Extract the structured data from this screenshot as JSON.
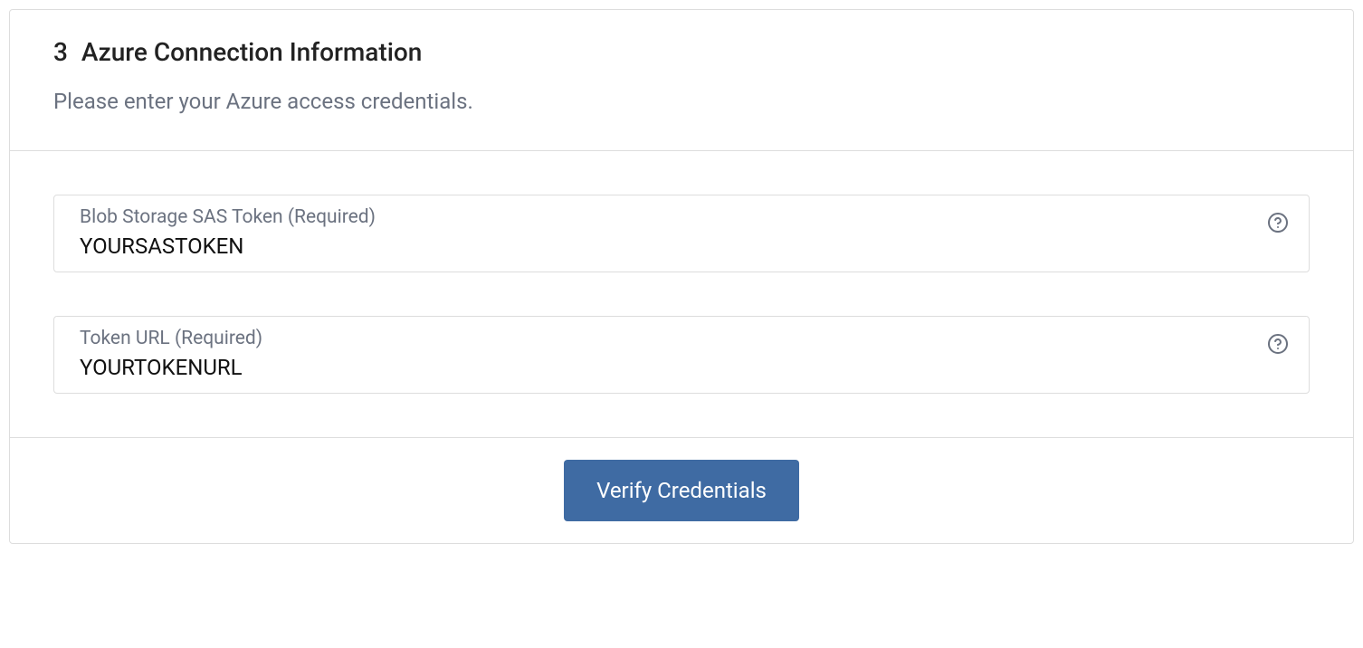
{
  "step": {
    "number": "3",
    "title": "Azure Connection Information",
    "subtitle": "Please enter your Azure access credentials."
  },
  "fields": {
    "sasToken": {
      "label": "Blob Storage SAS Token (Required)",
      "value": "YOURSASTOKEN"
    },
    "tokenUrl": {
      "label": "Token URL (Required)",
      "value": "YOURTOKENURL"
    }
  },
  "footer": {
    "verifyLabel": "Verify Credentials"
  }
}
